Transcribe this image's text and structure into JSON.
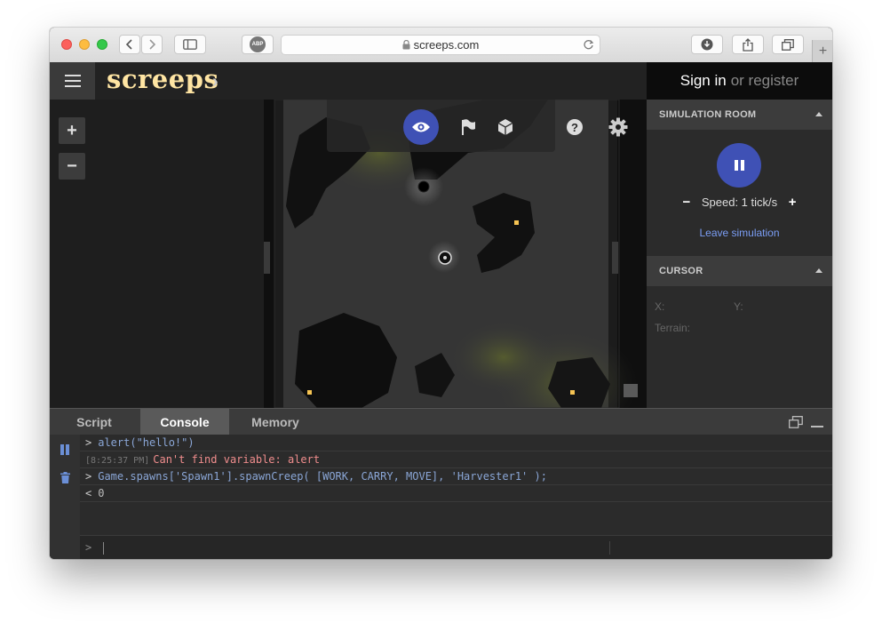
{
  "browser": {
    "url": "screeps.com",
    "abp_label": "ABP",
    "new_tab_symbol": "+"
  },
  "app": {
    "logo": "screeps",
    "logo_chevron": "›",
    "auth": {
      "sign_in": "Sign in",
      "or_register": "or register"
    }
  },
  "zoom": {
    "in": "+",
    "out": "−"
  },
  "map_menu": {
    "help_symbol": "?",
    "icons": [
      "eye-icon",
      "flag-icon",
      "cube-icon",
      "help-icon",
      "gear-icon"
    ]
  },
  "panel": {
    "simulation": {
      "title": "SIMULATION ROOM",
      "speed_minus": "−",
      "speed_label": "Speed: 1 tick/s",
      "speed_plus": "+",
      "leave": "Leave simulation"
    },
    "cursor": {
      "title": "CURSOR",
      "x_label": "X:",
      "y_label": "Y:",
      "terrain_label": "Terrain:"
    }
  },
  "bottom": {
    "tabs": [
      "Script",
      "Console",
      "Memory"
    ],
    "active_tab": "Console",
    "console_lines": [
      {
        "kind": "input",
        "prefix": ">",
        "text": "alert(\"hello!\")"
      },
      {
        "kind": "error",
        "time": "[8:25:37 PM]",
        "text": "Can't find variable: alert"
      },
      {
        "kind": "input",
        "prefix": ">",
        "text": "Game.spawns['Spawn1'].spawnCreep( [WORK, CARRY, MOVE], 'Harvester1' );"
      },
      {
        "kind": "output",
        "prefix": "<",
        "text": "0"
      }
    ],
    "prompt_symbol": ">"
  },
  "colors": {
    "accent": "#3f51b5",
    "logo": "#ffe5a3",
    "link": "#7b9ef5",
    "error": "#f08d8d",
    "console_text": "#8aa6d6"
  }
}
